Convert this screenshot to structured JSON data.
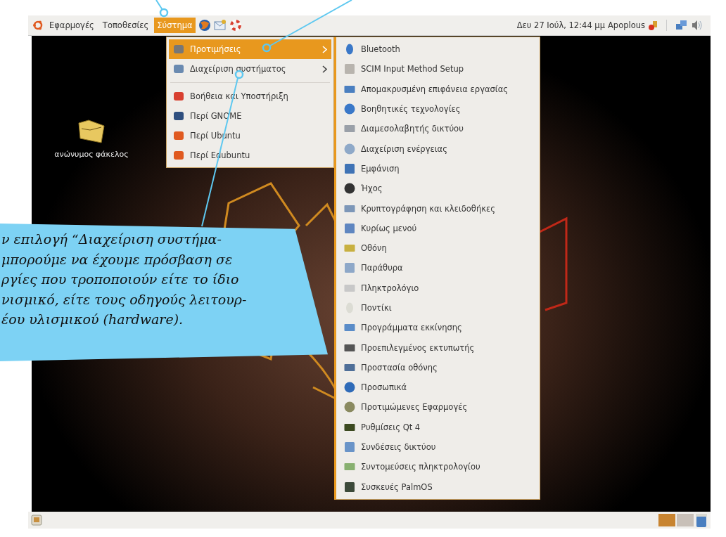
{
  "top_panel": {
    "menus": [
      {
        "label": "Εφαρμογές",
        "selected": false
      },
      {
        "label": "Τοποθεσίες",
        "selected": false
      },
      {
        "label": "Σύστημα",
        "selected": true
      }
    ],
    "clock": "Δευ 27 Ιούλ, 12:44 μμ",
    "user": "Apoplous"
  },
  "desktop": {
    "icons": [
      {
        "label": "ανώνυμος φάκελος"
      }
    ]
  },
  "system_menu": {
    "items": [
      {
        "kind": "item",
        "label": "Προτιμήσεις",
        "submenu": true,
        "selected": true
      },
      {
        "kind": "item",
        "label": "Διαχείριση συστήματος",
        "submenu": true,
        "selected": false
      },
      {
        "kind": "separator"
      },
      {
        "kind": "item",
        "label": "Βοήθεια και Υποστήριξη",
        "submenu": false,
        "selected": false
      },
      {
        "kind": "item",
        "label": "Περί GNOME",
        "submenu": false,
        "selected": false
      },
      {
        "kind": "item",
        "label": "Περί Ubuntu",
        "submenu": false,
        "selected": false
      },
      {
        "kind": "item",
        "label": "Περί Edubuntu",
        "submenu": false,
        "selected": false
      }
    ]
  },
  "preferences_submenu": {
    "items": [
      {
        "label": "Bluetooth"
      },
      {
        "label": "SCIM Input Method Setup"
      },
      {
        "label": "Απομακρυσμένη επιφάνεια εργασίας"
      },
      {
        "label": "Βοηθητικές τεχνολογίες"
      },
      {
        "label": "Διαμεσολαβητής δικτύου"
      },
      {
        "label": "Διαχείριση ενέργειας"
      },
      {
        "label": "Εμφάνιση"
      },
      {
        "label": "Ήχος"
      },
      {
        "label": "Κρυπτογράφηση και κλειδοθήκες"
      },
      {
        "label": "Κυρίως μενού"
      },
      {
        "label": "Οθόνη"
      },
      {
        "label": "Παράθυρα"
      },
      {
        "label": "Πληκτρολόγιο"
      },
      {
        "label": "Ποντίκι"
      },
      {
        "label": "Προγράμματα εκκίνησης"
      },
      {
        "label": "Προεπιλεγμένος εκτυπωτής"
      },
      {
        "label": "Προστασία οθόνης"
      },
      {
        "label": "Προσωπικά"
      },
      {
        "label": "Προτιμώμενες Εφαρμογές"
      },
      {
        "label": "Ρυθμίσεις Qt 4"
      },
      {
        "label": "Συνδέσεις δικτύου"
      },
      {
        "label": "Συντομεύσεις πληκτρολογίου"
      },
      {
        "label": "Συσκευές PalmOS"
      }
    ]
  },
  "callout": {
    "lines": [
      "ν επιλογή “Διαχείριση συστήμα-",
      "μπορούμε να έχουμε πρόσβαση σε",
      "ργίες που τροποποιούν είτε το ίδιο",
      "νισμικό, είτε τους οδηγούς λειτουρ-",
      "έου υλισμικού (hardware)."
    ]
  }
}
